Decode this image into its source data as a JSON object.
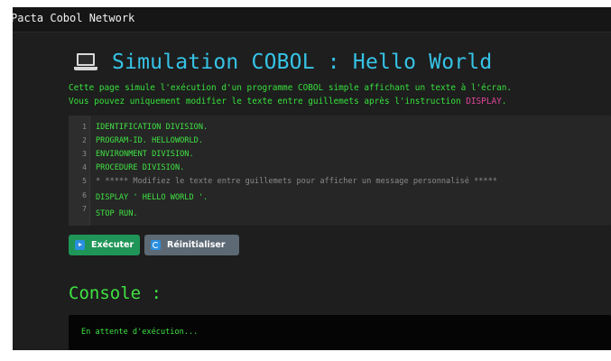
{
  "app": {
    "title": "Pacta Cobol Network"
  },
  "header": {
    "icon": "laptop-icon",
    "title": "Simulation COBOL : Hello World"
  },
  "description": {
    "line1": "Cette page simule l'exécution d'un programme COBOL simple affichant un texte à l'écran.",
    "line2_prefix": "Vous pouvez uniquement modifier le texte entre guillemets après l'instruction ",
    "line2_keyword": "DISPLAY",
    "line2_suffix": "."
  },
  "editor": {
    "line_numbers": [
      "1",
      "2",
      "3",
      "4",
      "5",
      "6",
      "7"
    ],
    "lines": [
      "IDENTIFICATION DIVISION.",
      "PROGRAM-ID. HELLOWORLD.",
      "ENVIRONMENT DIVISION.",
      "PROCEDURE DIVISION.",
      "* ***** Modifiez le texte entre guillemets pour afficher un message personnalisé *****",
      "DISPLAY ' HELLO WORLD '.",
      "STOP RUN."
    ]
  },
  "buttons": {
    "run_label": "Exécuter",
    "run_icon": "play-icon",
    "reset_label": "Réinitialiser",
    "reset_icon": "refresh-icon"
  },
  "console": {
    "title": "Console :",
    "output": "En attente d'exécution..."
  },
  "colors": {
    "title": "#36c3e6",
    "code_green": "#3fe242",
    "keyword_pink": "#e0459a",
    "run_button": "#1f9557",
    "reset_button": "#5d6a75",
    "background": "#1e1e1e"
  }
}
